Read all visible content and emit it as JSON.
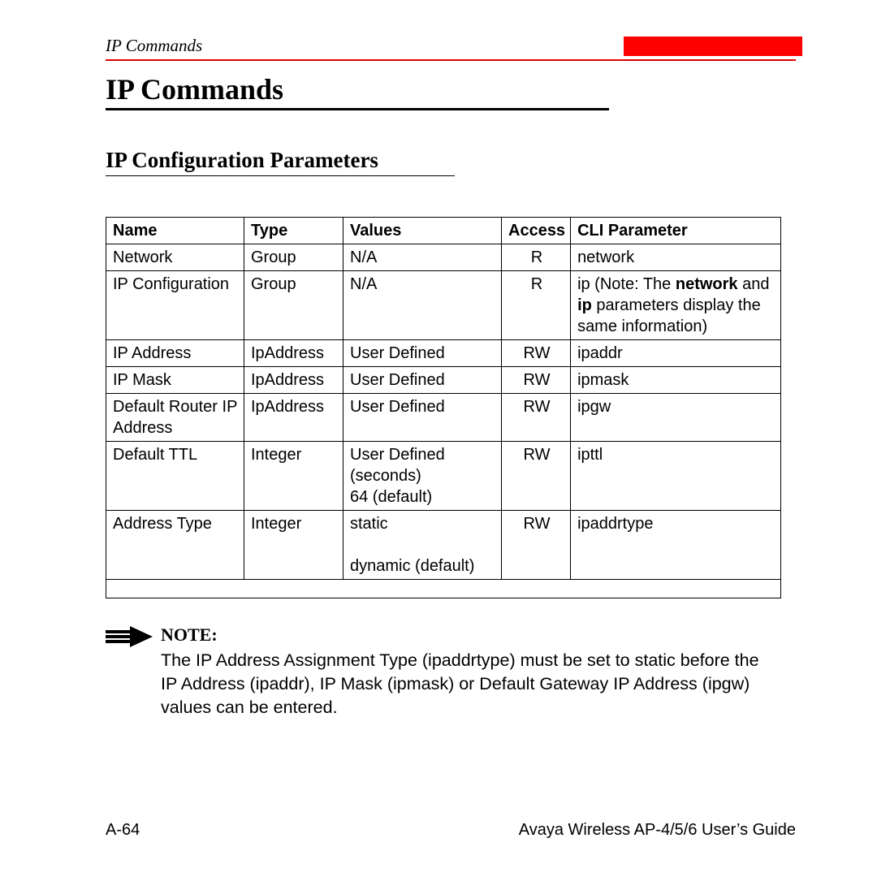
{
  "header": {
    "running_title": "IP Commands"
  },
  "h1": "IP Commands",
  "h2": "IP Configuration Parameters",
  "table": {
    "headers": {
      "name": "Name",
      "type": "Type",
      "values": "Values",
      "access": "Access",
      "cli": "CLI Parameter"
    },
    "rows": [
      {
        "name": "Network",
        "type": "Group",
        "values": "N/A",
        "access": "R",
        "cli_plain": "network"
      },
      {
        "name": "IP Configuration",
        "type": "Group",
        "values": "N/A",
        "access": "R",
        "cli_parts": {
          "pre": "ip (Note: The ",
          "b1": "network",
          "mid": " and ",
          "b2": "ip",
          "post": " parameters display the same information)"
        }
      },
      {
        "name": "IP Address",
        "type": "IpAddress",
        "values": "User Defined",
        "access": "RW",
        "cli_plain": "ipaddr"
      },
      {
        "name": "IP Mask",
        "type": "IpAddress",
        "values": "User Defined",
        "access": "RW",
        "cli_plain": "ipmask"
      },
      {
        "name": "Default Router IP Address",
        "type": "IpAddress",
        "values": "User Defined",
        "access": "RW",
        "cli_plain": "ipgw"
      },
      {
        "name": "Default TTL",
        "type": "Integer",
        "values": "User Defined (seconds)\n64 (default)",
        "access": "RW",
        "cli_plain": "ipttl"
      },
      {
        "name": "Address Type",
        "type": "Integer",
        "values": "static\n\ndynamic (default)",
        "access": "RW",
        "cli_plain": "ipaddrtype"
      }
    ]
  },
  "note": {
    "label": "NOTE:",
    "text": "The IP Address Assignment Type (ipaddrtype) must be set to static before the IP Address (ipaddr), IP Mask (ipmask) or Default Gateway IP Address (ipgw) values can be entered."
  },
  "footer": {
    "page": "A-64",
    "doc": "Avaya Wireless AP-4/5/6 User’s Guide"
  }
}
